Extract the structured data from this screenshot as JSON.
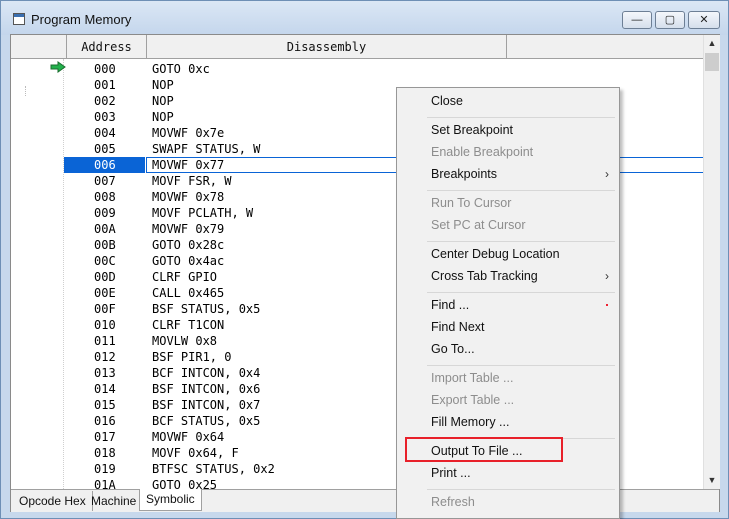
{
  "window": {
    "title": "Program Memory",
    "min_label": "—",
    "max_label": "▢",
    "close_label": "✕"
  },
  "table": {
    "columns": [
      "",
      "Address",
      "Disassembly",
      ""
    ],
    "selected_index": 6,
    "rows": [
      {
        "addr": "000",
        "dis": "GOTO 0xc"
      },
      {
        "addr": "001",
        "dis": "NOP"
      },
      {
        "addr": "002",
        "dis": "NOP"
      },
      {
        "addr": "003",
        "dis": "NOP"
      },
      {
        "addr": "004",
        "dis": "MOVWF 0x7e"
      },
      {
        "addr": "005",
        "dis": "SWAPF STATUS, W"
      },
      {
        "addr": "006",
        "dis": "MOVWF 0x77"
      },
      {
        "addr": "007",
        "dis": "MOVF FSR, W"
      },
      {
        "addr": "008",
        "dis": "MOVWF 0x78"
      },
      {
        "addr": "009",
        "dis": "MOVF PCLATH, W"
      },
      {
        "addr": "00A",
        "dis": "MOVWF 0x79"
      },
      {
        "addr": "00B",
        "dis": "GOTO 0x28c"
      },
      {
        "addr": "00C",
        "dis": "GOTO 0x4ac"
      },
      {
        "addr": "00D",
        "dis": "CLRF GPIO"
      },
      {
        "addr": "00E",
        "dis": "CALL 0x465"
      },
      {
        "addr": "00F",
        "dis": "BSF STATUS, 0x5"
      },
      {
        "addr": "010",
        "dis": "CLRF T1CON"
      },
      {
        "addr": "011",
        "dis": "MOVLW 0x8"
      },
      {
        "addr": "012",
        "dis": "BSF PIR1, 0"
      },
      {
        "addr": "013",
        "dis": "BCF INTCON, 0x4"
      },
      {
        "addr": "014",
        "dis": "BSF INTCON, 0x6"
      },
      {
        "addr": "015",
        "dis": "BSF INTCON, 0x7"
      },
      {
        "addr": "016",
        "dis": "BCF STATUS, 0x5"
      },
      {
        "addr": "017",
        "dis": "MOVWF 0x64"
      },
      {
        "addr": "018",
        "dis": "MOVF 0x64, F"
      },
      {
        "addr": "019",
        "dis": "BTFSC STATUS, 0x2"
      },
      {
        "addr": "01A",
        "dis": "GOTO 0x25"
      }
    ]
  },
  "scroll": {
    "up": "▲",
    "down": "▼"
  },
  "tabs": [
    "Opcode Hex",
    "Machine",
    "Symbolic"
  ],
  "active_tab": "Symbolic",
  "context_menu": {
    "items": [
      {
        "label": "Close",
        "enabled": true
      },
      {
        "label": "Set Breakpoint",
        "enabled": true
      },
      {
        "label": "Enable Breakpoint",
        "enabled": false
      },
      {
        "label": "Breakpoints",
        "enabled": true,
        "submenu": true
      },
      {
        "label": "Run To Cursor",
        "enabled": false
      },
      {
        "label": "Set PC at Cursor",
        "enabled": false
      },
      {
        "label": "Center Debug Location",
        "enabled": true
      },
      {
        "label": "Cross Tab Tracking",
        "enabled": true,
        "submenu": true
      },
      {
        "label": "Find ...",
        "enabled": true
      },
      {
        "label": "Find Next",
        "enabled": true
      },
      {
        "label": "Go To...",
        "enabled": true
      },
      {
        "label": "Import Table ...",
        "enabled": false
      },
      {
        "label": "Export Table ...",
        "enabled": false
      },
      {
        "label": "Fill Memory ...",
        "enabled": true
      },
      {
        "label": "Output To File ...",
        "enabled": true,
        "highlighted": true
      },
      {
        "label": "Print ...",
        "enabled": true
      },
      {
        "label": "Refresh",
        "enabled": false
      }
    ],
    "submenu_glyph": "›"
  },
  "colors": {
    "selection": "#0a64d6",
    "pc_arrow": "#22b14c",
    "highlight_box": "#e8202a"
  }
}
